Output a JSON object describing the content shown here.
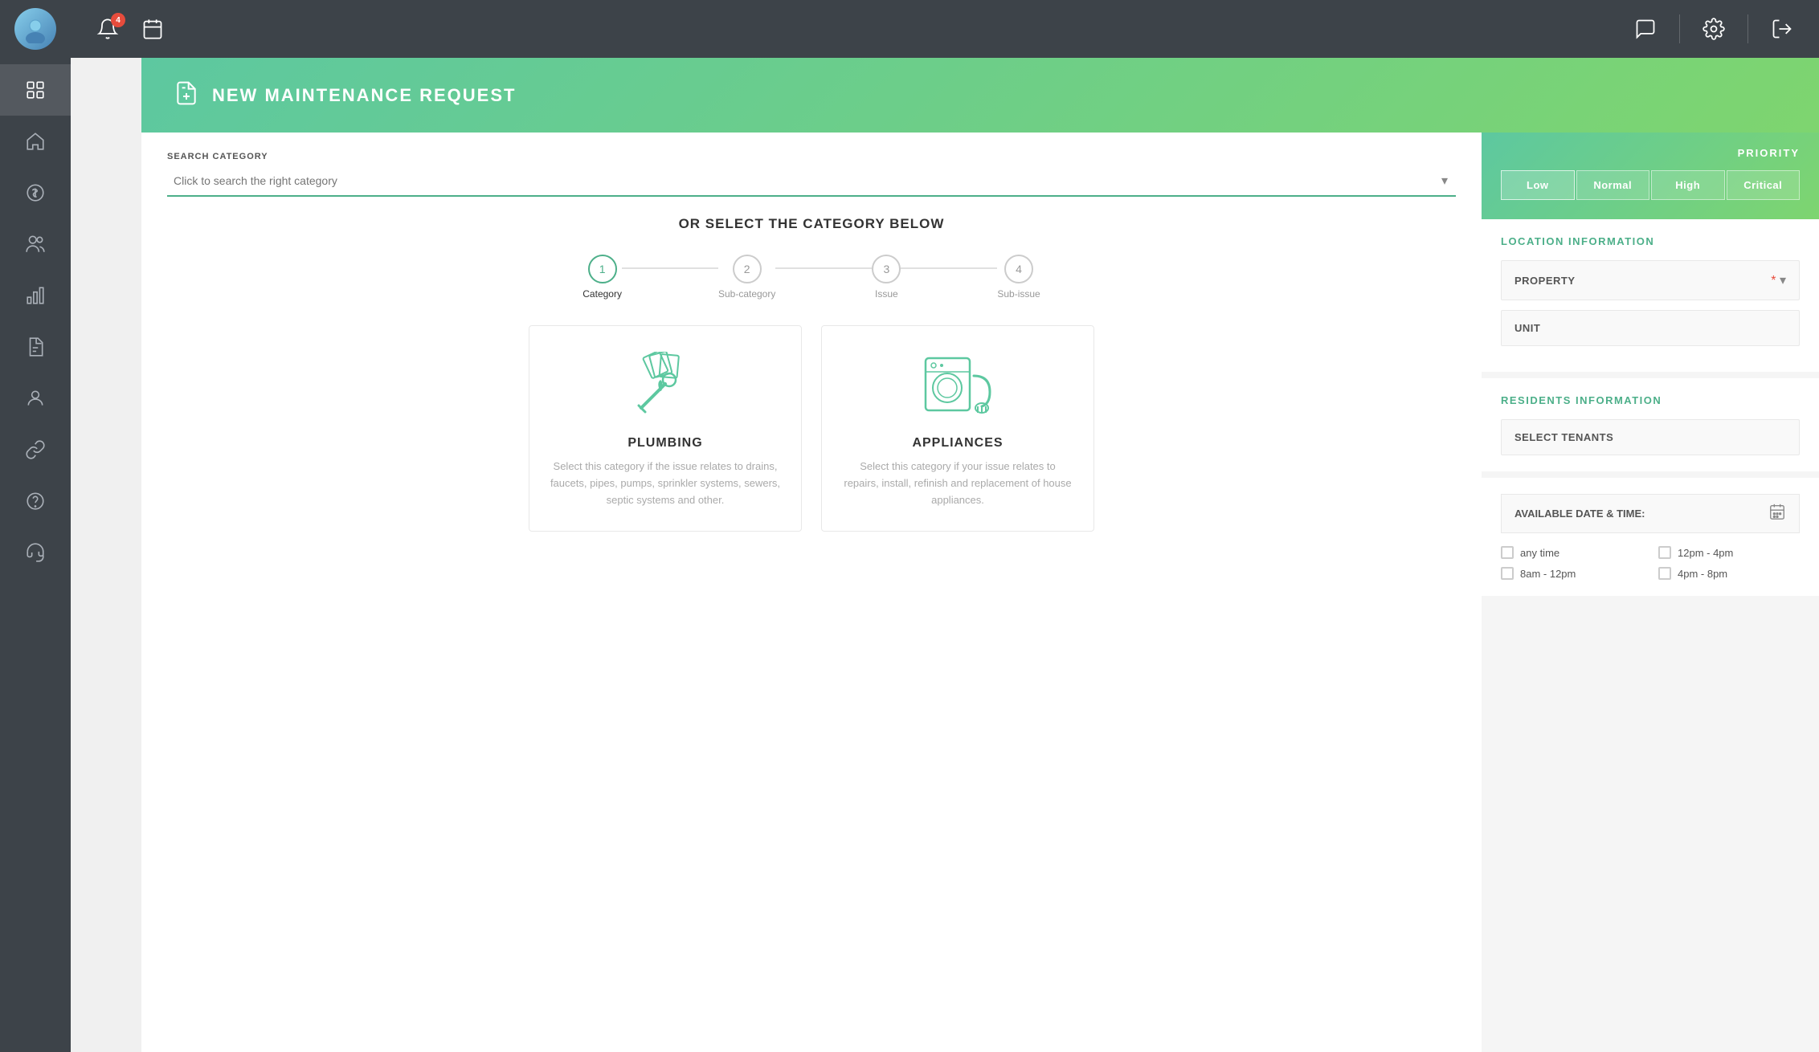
{
  "sidebar": {
    "nav_items": [
      {
        "id": "grid",
        "label": "Grid"
      },
      {
        "id": "home",
        "label": "Home"
      },
      {
        "id": "dollar",
        "label": "Payments"
      },
      {
        "id": "users",
        "label": "Users"
      },
      {
        "id": "chart",
        "label": "Reports"
      },
      {
        "id": "document",
        "label": "Documents"
      },
      {
        "id": "person",
        "label": "Profile"
      },
      {
        "id": "link",
        "label": "Links"
      },
      {
        "id": "question",
        "label": "Help"
      },
      {
        "id": "support",
        "label": "Support"
      }
    ]
  },
  "topbar": {
    "notification_badge": "4",
    "icons": [
      "notification",
      "calendar",
      "message",
      "settings",
      "exit"
    ]
  },
  "page": {
    "title": "NEW MAINTENANCE REQUEST"
  },
  "search": {
    "label": "SEARCH CATEGORY",
    "placeholder": "Click to search the right category"
  },
  "category_section": {
    "title": "OR SELECT THE CATEGORY BELOW",
    "steps": [
      {
        "number": "1",
        "label": "Category",
        "active": true
      },
      {
        "number": "2",
        "label": "Sub-category",
        "active": false
      },
      {
        "number": "3",
        "label": "Issue",
        "active": false
      },
      {
        "number": "4",
        "label": "Sub-issue",
        "active": false
      }
    ],
    "cards": [
      {
        "id": "plumbing",
        "title": "PLUMBING",
        "description": "Select this category if the issue relates to drains, faucets, pipes, pumps, sprinkler systems, sewers, septic systems and other."
      },
      {
        "id": "appliances",
        "title": "APPLIANCES",
        "description": "Select this category if your issue relates to repairs, install, refinish and replacement of house appliances."
      }
    ]
  },
  "right_panel": {
    "priority": {
      "label": "PRIORITY",
      "buttons": [
        "Low",
        "Normal",
        "High",
        "Critical"
      ],
      "selected": "Low"
    },
    "location": {
      "heading": "LOCATION INFORMATION",
      "property_label": "PROPERTY",
      "unit_label": "UNIT"
    },
    "residents": {
      "heading": "RESIDENTS INFORMATION",
      "select_tenants_label": "SELECT TENANTS"
    },
    "datetime": {
      "label": "AVAILABLE DATE & TIME:",
      "time_options": [
        "any time",
        "12pm - 4pm",
        "8am - 12pm",
        "4pm - 8pm"
      ]
    }
  }
}
